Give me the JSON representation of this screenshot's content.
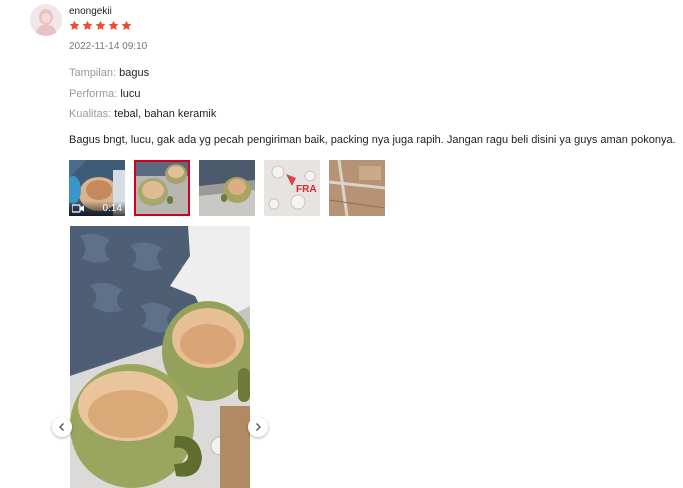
{
  "review": {
    "username": "enongekii",
    "rating": 5,
    "datetime": "2022-11-14 09:10",
    "attributes": [
      {
        "label": "Tampilan:",
        "value": "bagus"
      },
      {
        "label": "Performa:",
        "value": "lucu"
      },
      {
        "label": "Kualitas:",
        "value": "tebal, bahan keramik"
      }
    ],
    "comment": "Bagus bngt, lucu, gak ada yg pecah pengiriman baik, packing nya juga rapih. Jangan ragu beli disini ya guys aman pokonya.",
    "video_duration": "0:14",
    "fragile_text": "FRA"
  },
  "icons": {
    "star": "star-icon",
    "video": "video-camera-icon",
    "prev": "chevron-left-icon",
    "next": "chevron-right-icon"
  },
  "colors": {
    "star": "#ee4d2d",
    "selected_border": "#d0011b",
    "muted": "#999999"
  }
}
